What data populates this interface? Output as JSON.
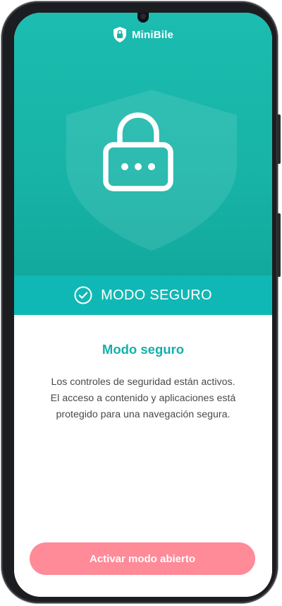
{
  "app": {
    "name": "MiniBile"
  },
  "hero": {
    "lock_icon": "lock-icon",
    "shield_icon": "shield-icon"
  },
  "banner": {
    "icon": "check-circle-icon",
    "label": "MODO SEGURO"
  },
  "content": {
    "title": "Modo seguro",
    "description_lines": [
      "Los controles de seguridad están activos.",
      "El acceso a contenido y aplicaciones está",
      "protegido para una navegación segura."
    ]
  },
  "cta": {
    "label": "Activar modo abierto"
  },
  "colors": {
    "hero_teal": "#17b4a7",
    "banner_teal": "#10b8b5",
    "title_teal": "#14b0aa",
    "cta_pink": "#ff8a98"
  }
}
